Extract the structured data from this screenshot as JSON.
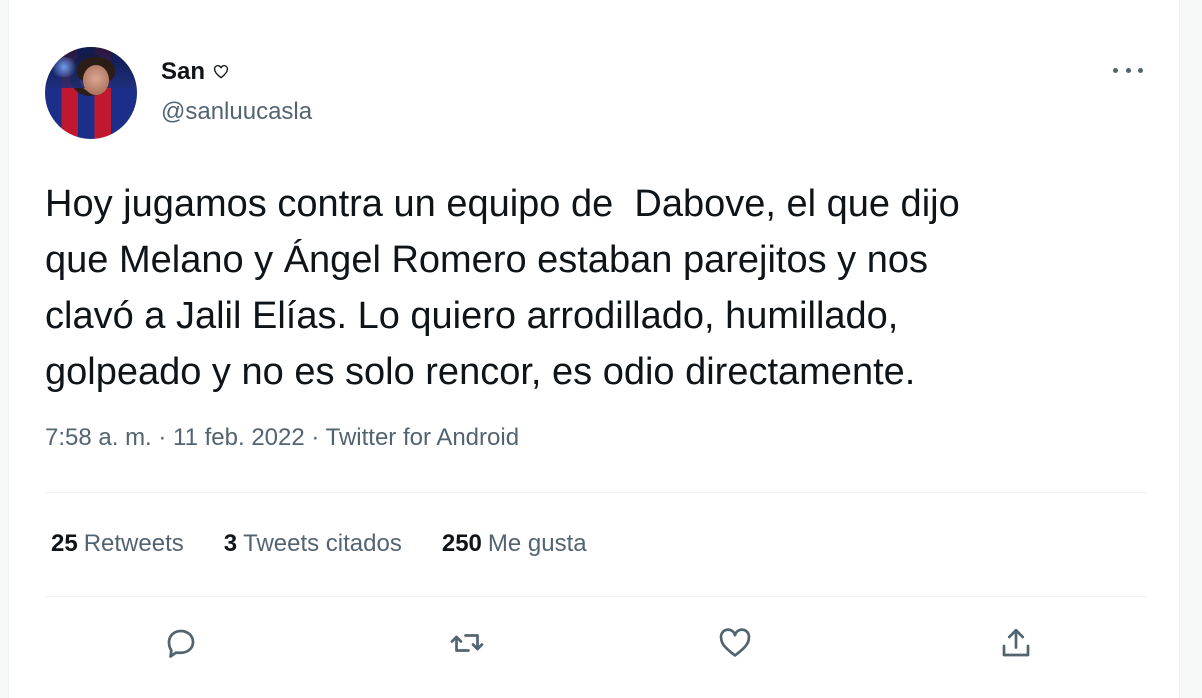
{
  "user": {
    "display_name": "San",
    "handle": "@sanluucasla"
  },
  "tweet": {
    "text": "Hoy jugamos contra un equipo de  Dabove, el que dijo\nque Melano y Ángel Romero estaban parejitos y nos\nclavó a Jalil Elías. Lo quiero arrodillado, humillado,\ngolpeado y no es solo rencor, es odio directamente.",
    "meta": "7:58 a. m. · 11 feb. 2022 · Twitter for Android"
  },
  "stats": {
    "retweets_count": "25",
    "retweets_label": "Retweets",
    "quotes_count": "3",
    "quotes_label": "Tweets citados",
    "likes_count": "250",
    "likes_label": "Me gusta"
  },
  "icons": {
    "name_badge": "heart-outline-icon",
    "more": "more-dots-icon",
    "reply": "reply-icon",
    "retweet": "retweet-icon",
    "like": "heart-icon",
    "share": "share-icon"
  },
  "colors": {
    "text_primary": "#0f1419",
    "text_secondary": "#536471",
    "divider": "#eff3f4"
  }
}
